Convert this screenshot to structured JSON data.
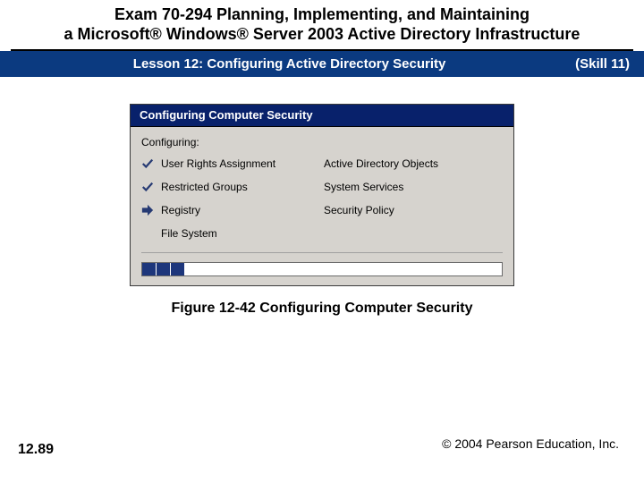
{
  "header": {
    "title_line1": "Exam 70-294 Planning, Implementing, and Maintaining",
    "title_line2": "a Microsoft® Windows® Server 2003 Active Directory Infrastructure"
  },
  "lesson_bar": {
    "lesson_title": "Lesson 12: Configuring Active Directory Security",
    "skill_label": "(Skill 11)"
  },
  "wizard": {
    "window_title": "Configuring Computer Security",
    "subtitle": "Configuring:",
    "items": [
      {
        "status": "done",
        "label": "User Rights Assignment"
      },
      {
        "status": "pending",
        "label": "Active Directory Objects"
      },
      {
        "status": "done",
        "label": "Restricted Groups"
      },
      {
        "status": "pending",
        "label": "System Services"
      },
      {
        "status": "current",
        "label": "Registry"
      },
      {
        "status": "pending",
        "label": "Security Policy"
      },
      {
        "status": "pending",
        "label": "File System"
      },
      {
        "status": "pending",
        "label": ""
      }
    ],
    "progress_segments": 3
  },
  "figure_caption": "Figure 12-42 Configuring Computer Security",
  "page_number": "12.89",
  "copyright": "© 2004 Pearson Education, Inc."
}
